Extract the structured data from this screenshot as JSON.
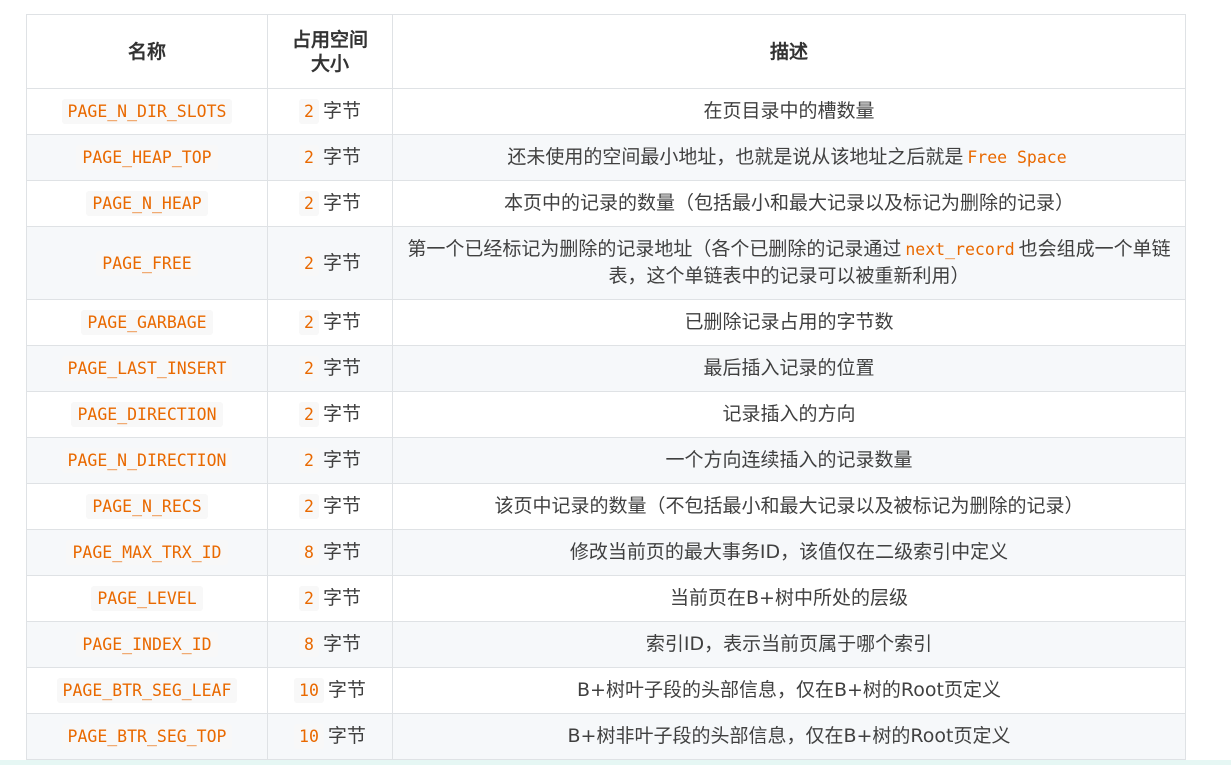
{
  "table": {
    "headers": {
      "name": "名称",
      "size_line1": "占用空间",
      "size_line2": "大小",
      "desc": "描述"
    },
    "unit": "字节",
    "rows": [
      {
        "name": "PAGE_N_DIR_SLOTS",
        "size": "2",
        "desc_before": "在页目录中的槽数量",
        "desc_code": "",
        "desc_after": ""
      },
      {
        "name": "PAGE_HEAP_TOP",
        "size": "2",
        "desc_before": "还未使用的空间最小地址，也就是说从该地址之后就是",
        "desc_code": "Free Space",
        "desc_after": ""
      },
      {
        "name": "PAGE_N_HEAP",
        "size": "2",
        "desc_before": "本页中的记录的数量（包括最小和最大记录以及标记为删除的记录）",
        "desc_code": "",
        "desc_after": ""
      },
      {
        "name": "PAGE_FREE",
        "size": "2",
        "desc_before": "第一个已经标记为删除的记录地址（各个已删除的记录通过",
        "desc_code": "next_record",
        "desc_after": "也会组成一个单链表，这个单链表中的记录可以被重新利用）"
      },
      {
        "name": "PAGE_GARBAGE",
        "size": "2",
        "desc_before": "已删除记录占用的字节数",
        "desc_code": "",
        "desc_after": ""
      },
      {
        "name": "PAGE_LAST_INSERT",
        "size": "2",
        "desc_before": "最后插入记录的位置",
        "desc_code": "",
        "desc_after": ""
      },
      {
        "name": "PAGE_DIRECTION",
        "size": "2",
        "desc_before": "记录插入的方向",
        "desc_code": "",
        "desc_after": ""
      },
      {
        "name": "PAGE_N_DIRECTION",
        "size": "2",
        "desc_before": "一个方向连续插入的记录数量",
        "desc_code": "",
        "desc_after": ""
      },
      {
        "name": "PAGE_N_RECS",
        "size": "2",
        "desc_before": "该页中记录的数量（不包括最小和最大记录以及被标记为删除的记录）",
        "desc_code": "",
        "desc_after": ""
      },
      {
        "name": "PAGE_MAX_TRX_ID",
        "size": "8",
        "desc_before": "修改当前页的最大事务ID，该值仅在二级索引中定义",
        "desc_code": "",
        "desc_after": ""
      },
      {
        "name": "PAGE_LEVEL",
        "size": "2",
        "desc_before": "当前页在B+树中所处的层级",
        "desc_code": "",
        "desc_after": ""
      },
      {
        "name": "PAGE_INDEX_ID",
        "size": "8",
        "desc_before": "索引ID，表示当前页属于哪个索引",
        "desc_code": "",
        "desc_after": ""
      },
      {
        "name": "PAGE_BTR_SEG_LEAF",
        "size": "10",
        "desc_before": "B+树叶子段的头部信息，仅在B+树的Root页定义",
        "desc_code": "",
        "desc_after": ""
      },
      {
        "name": "PAGE_BTR_SEG_TOP",
        "size": "10",
        "desc_before": "B+树非叶子段的头部信息，仅在B+树的Root页定义",
        "desc_code": "",
        "desc_after": ""
      }
    ]
  }
}
